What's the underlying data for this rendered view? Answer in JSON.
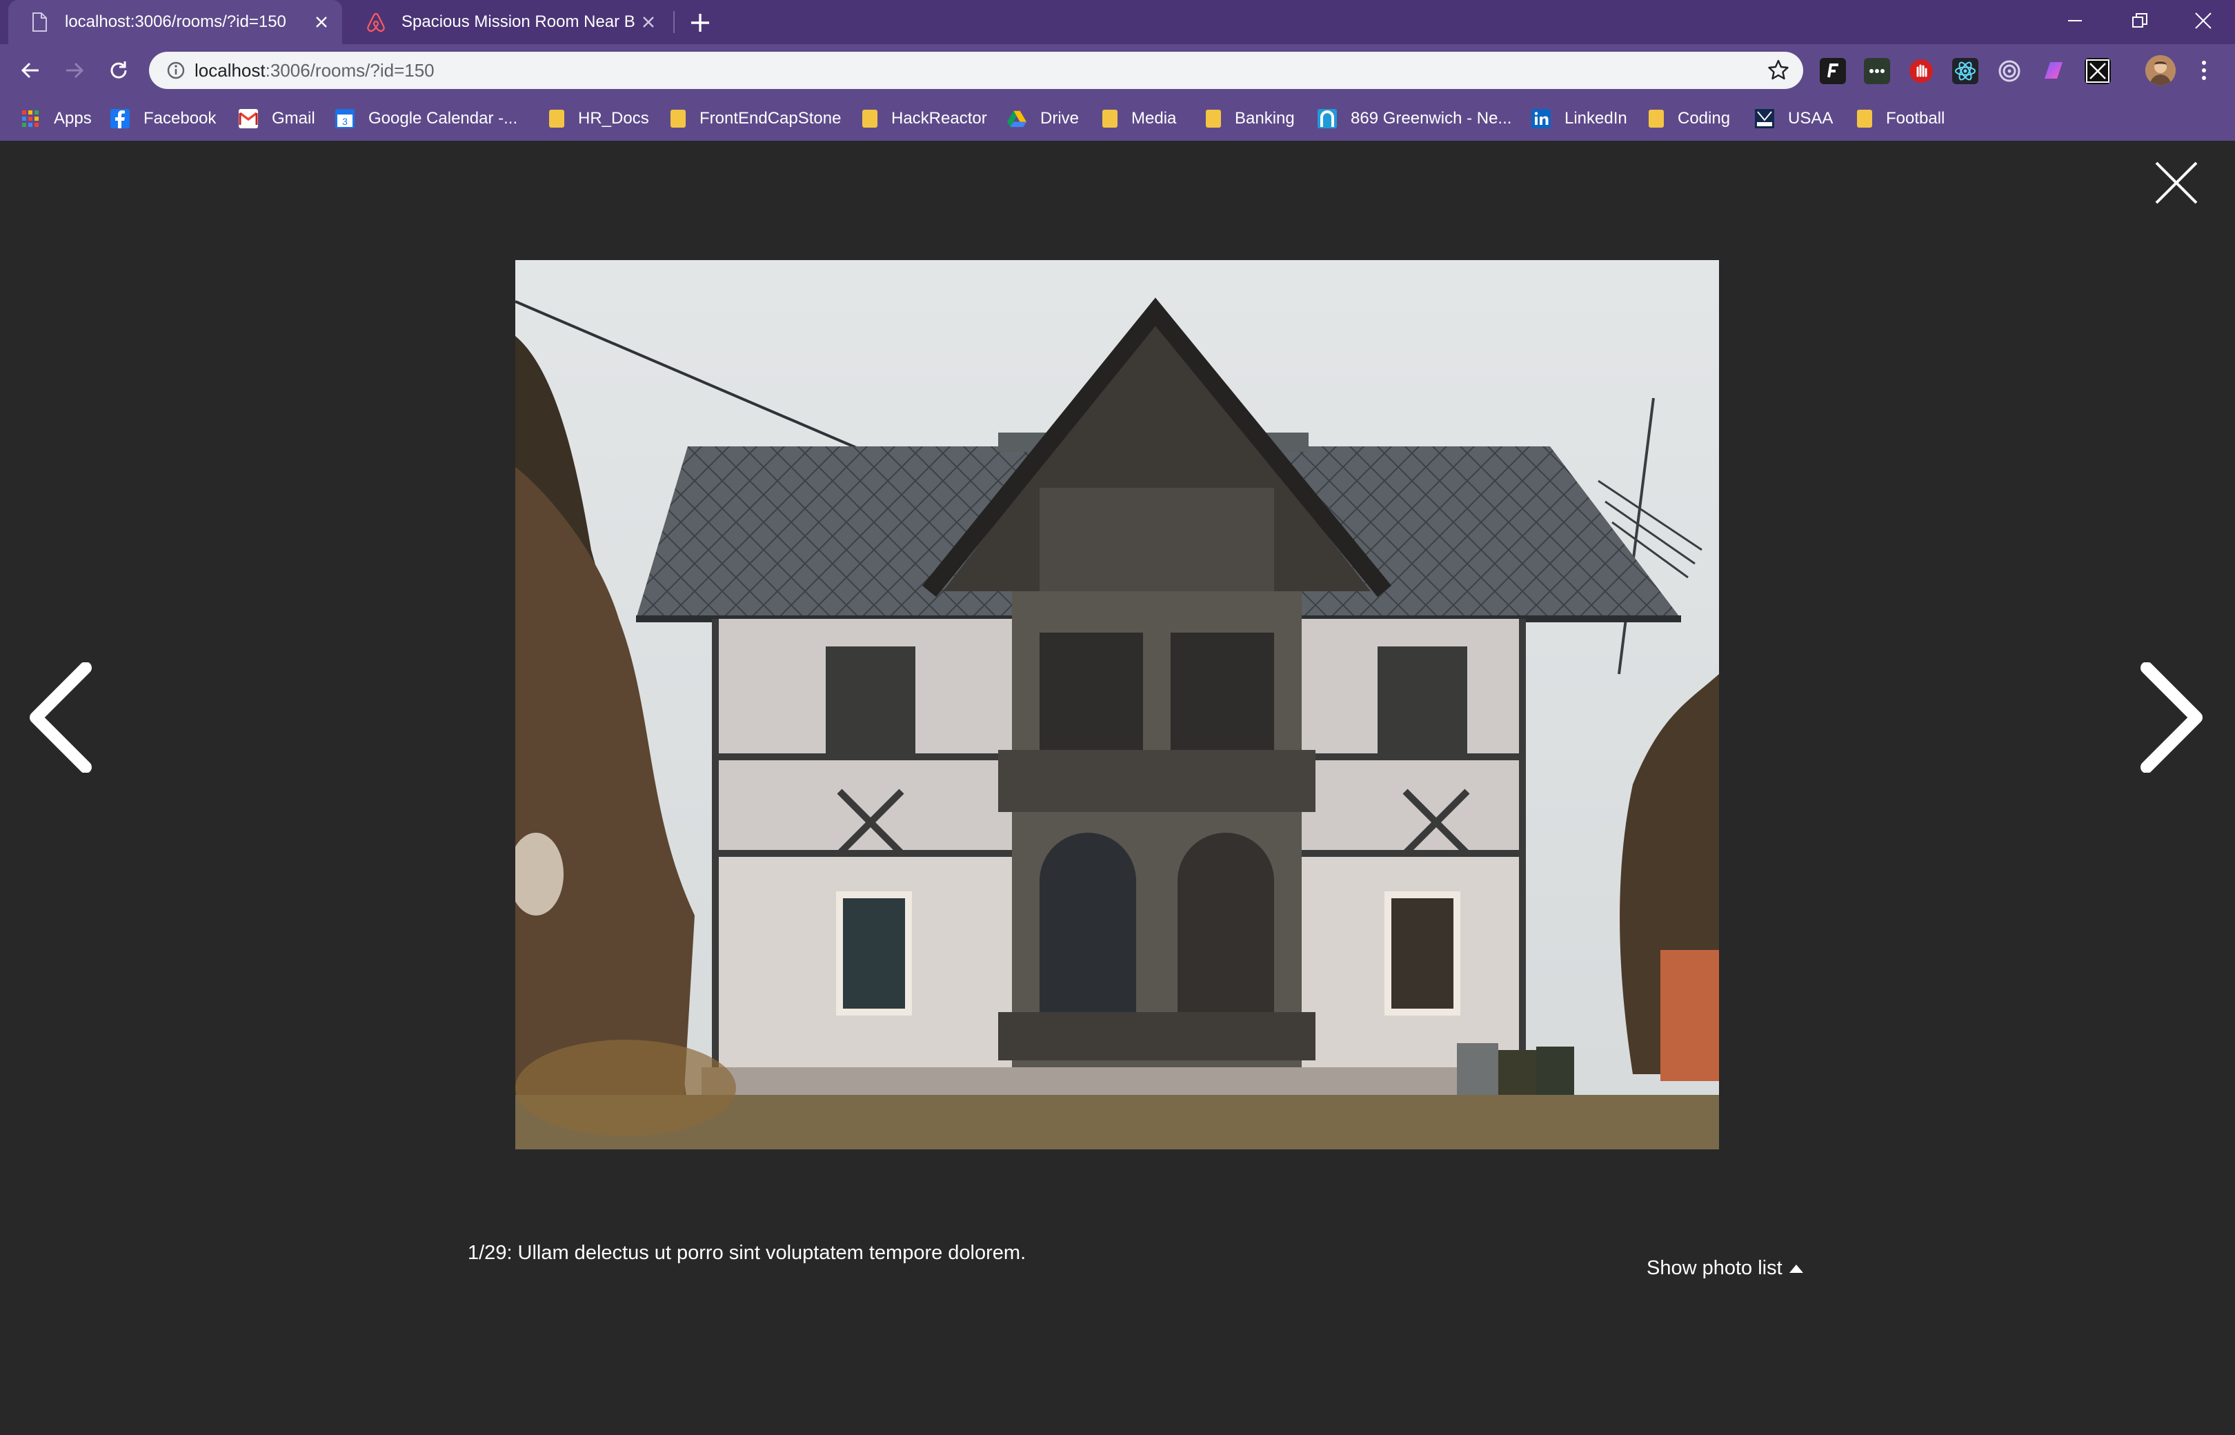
{
  "browser": {
    "tabs": [
      {
        "title": "localhost:3006/rooms/?id=150",
        "active": true,
        "icon": "page-icon"
      },
      {
        "title": "Spacious Mission Room Near BART",
        "active": false,
        "icon": "airbnb-icon"
      }
    ],
    "url_host": "localhost",
    "url_rest": ":3006/rooms/?id=150",
    "bookmarks": [
      {
        "label": "Apps",
        "icon": "apps-grid-icon"
      },
      {
        "label": "Facebook",
        "icon": "facebook-icon"
      },
      {
        "label": "Gmail",
        "icon": "gmail-icon"
      },
      {
        "label": "Google Calendar -...",
        "icon": "calendar-icon"
      },
      {
        "label": "HR_Docs",
        "icon": "folder-icon"
      },
      {
        "label": "FrontEndCapStone",
        "icon": "folder-icon"
      },
      {
        "label": "HackReactor",
        "icon": "folder-icon"
      },
      {
        "label": "Drive",
        "icon": "drive-icon"
      },
      {
        "label": "Media",
        "icon": "folder-icon"
      },
      {
        "label": "Banking",
        "icon": "folder-icon"
      },
      {
        "label": "869 Greenwich - Ne...",
        "icon": "site-icon"
      },
      {
        "label": "LinkedIn",
        "icon": "linkedin-icon"
      },
      {
        "label": "Coding",
        "icon": "folder-icon"
      },
      {
        "label": "USAA",
        "icon": "usaa-icon"
      },
      {
        "label": "Football",
        "icon": "folder-icon"
      }
    ]
  },
  "lightbox": {
    "photo_index": "1/29",
    "caption_separator": ":",
    "caption": "Ullam delectus ut porro sint voluptatem tempore dolorem.",
    "show_photo_list": "Show photo list",
    "photo_subject": "house-photo"
  },
  "colors": {
    "chrome": "#4b3476",
    "toolbar": "#5e4a8a",
    "background": "#282828"
  }
}
